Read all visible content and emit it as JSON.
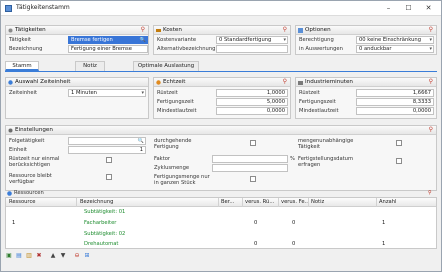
{
  "window": {
    "title": "Tätigkeitenstamm",
    "minimize": "–",
    "maximize": "☐",
    "close": "✕"
  },
  "taetigkeiten": {
    "header": "Tätigkeiten",
    "label_taetigkeit": "Tätigkeit",
    "value_taetigkeit": "Bremse fertigen",
    "label_bezeichnung": "Bezeichnung",
    "value_bezeichnung": "Fertigung einer Bremse"
  },
  "kosten": {
    "header": "Kosten",
    "label_variante": "Kostenvariante",
    "value_variante": "0 Standardfertigung",
    "label_alternativ": "Alternativbezeichnung",
    "value_alternativ": ""
  },
  "optionen": {
    "header": "Optionen",
    "label_berechtigung": "Berechtigung",
    "value_berechtigung": "00 keine Einschränkung",
    "label_auswertungen": "in Auswertungen",
    "value_auswertungen": "0 anduckbar"
  },
  "tabs": [
    "Stamm",
    "Notiz",
    "Optimale Auslastung"
  ],
  "zeiteinheit": {
    "header": "Auswahl Zeiteinheit",
    "label": "Zeiteinheit",
    "value": "1 Minuten"
  },
  "echtzeit": {
    "header": "Echtzeit",
    "rows": [
      {
        "label": "Rüstzeit",
        "value": "1,0000"
      },
      {
        "label": "Fertigungszeit",
        "value": "5,0000"
      },
      {
        "label": "Mindestlaufzeit",
        "value": "0,0000"
      }
    ]
  },
  "industrieminuten": {
    "header": "Industrieminuten",
    "rows": [
      {
        "label": "Rüstzeit",
        "value": "1,6667"
      },
      {
        "label": "Fertigungszeit",
        "value": "8,3333"
      },
      {
        "label": "Mindestlaufzeit",
        "value": "0,0000"
      }
    ]
  },
  "einstellungen": {
    "header": "Einstellungen",
    "folgetaetigkeit": "Folgetätigkeit",
    "einheit": "Einheit",
    "einheit_value": "1",
    "ruestzeit_einmal": "Rüstzeit nur einmal berücksichtigen",
    "ressource_bleibt": "Ressource bleibt verfügbar",
    "durchgehende": "durchgehende Fertigung",
    "faktor": "Faktor",
    "faktor_unit": "%",
    "zyklusmenge": "Zyklusmenge",
    "fertigungsmenge": "Fertigungsmenge nur in ganzen Stück",
    "mengenunabhaengig": "mengenunabhängige Tätigkeit",
    "fertigstellungsdatum": "Fertigstellungsdatum erfragen"
  },
  "ressourcen": {
    "header": "Ressourcen",
    "columns": [
      "Ressource",
      "Bezeichnung",
      "Ber...",
      "verus. Rü...",
      "verus. Fe...",
      "Notiz",
      "Anzahl"
    ],
    "rows": [
      {
        "ressource": "",
        "bezeichnung": "Subtätigkeit: 01",
        "ber": "",
        "rue": "",
        "fe": "",
        "notiz": "",
        "anzahl": ""
      },
      {
        "ressource": "1",
        "bezeichnung": "Facharbeiter",
        "ber": "",
        "rue": "0",
        "fe": "0",
        "notiz": "",
        "anzahl": "1"
      },
      {
        "ressource": "",
        "bezeichnung": "Subtätigkeit: 02",
        "ber": "",
        "rue": "",
        "fe": "",
        "notiz": "",
        "anzahl": ""
      },
      {
        "ressource": "",
        "bezeichnung": "Drehautomat",
        "ber": "",
        "rue": "0",
        "fe": "0",
        "notiz": "",
        "anzahl": "1"
      }
    ]
  },
  "colors": {
    "accent": "#3b7dd8",
    "pin": "#c0392b",
    "green_text": "#1d8c2e"
  }
}
